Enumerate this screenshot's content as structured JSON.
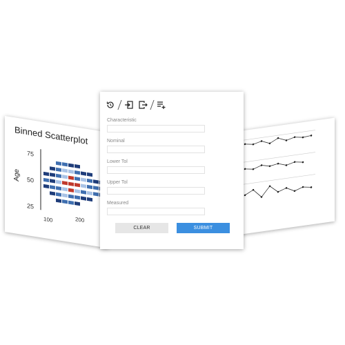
{
  "left_chart": {
    "title": "Binned Scatterplot",
    "ylabel": "Age",
    "yticks": [
      "75",
      "50",
      "25"
    ],
    "xticks": [
      "100",
      "200"
    ]
  },
  "dialog": {
    "fields": [
      {
        "label": "Characteristic",
        "value": ""
      },
      {
        "label": "Nominal",
        "value": ""
      },
      {
        "label": "Lower Tol",
        "value": ""
      },
      {
        "label": "Upper Tol",
        "value": ""
      },
      {
        "label": "Measured",
        "value": ""
      }
    ],
    "clear_label": "CLEAR",
    "submit_label": "SUBMIT"
  },
  "icons": [
    "history-icon",
    "import-icon",
    "export-icon",
    "add-list-icon"
  ],
  "colors": {
    "submit": "#3b8fe0",
    "clear": "#e6e6e6",
    "heat_dark": "#1f3d7a",
    "heat_mid": "#3f6fb0",
    "heat_light": "#a9c3e6",
    "heat_red": "#c0392b"
  }
}
